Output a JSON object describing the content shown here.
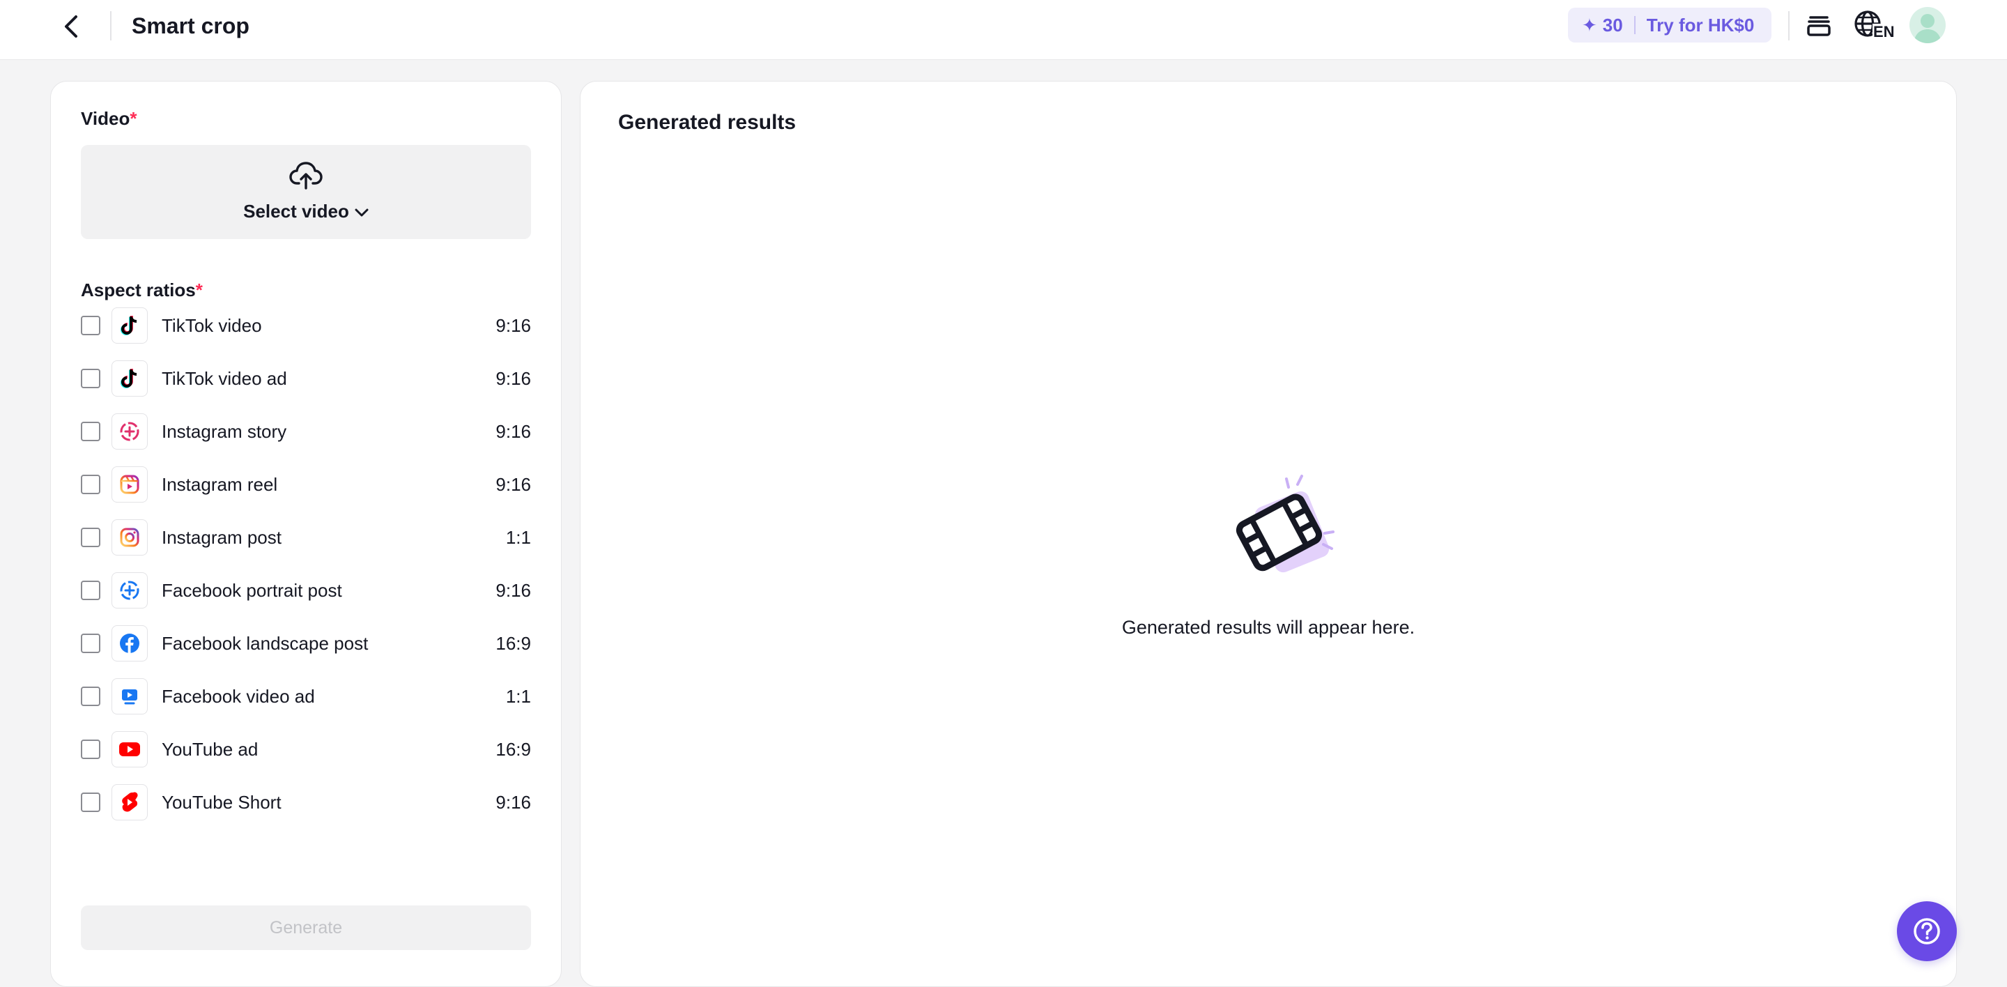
{
  "header": {
    "title": "Smart crop",
    "credits": "30",
    "try_label": "Try for HK$0",
    "language_code": "EN"
  },
  "left_panel": {
    "video_label": "Video",
    "video_required_mark": "*",
    "select_video_label": "Select video",
    "aspect_ratios_label": "Aspect ratios",
    "aspect_required_mark": "*",
    "ratios": [
      {
        "name": "TikTok video",
        "ratio": "9:16",
        "icon": "tiktok-icon",
        "checked": false
      },
      {
        "name": "TikTok video ad",
        "ratio": "9:16",
        "icon": "tiktok-icon",
        "checked": false
      },
      {
        "name": "Instagram story",
        "ratio": "9:16",
        "icon": "instagram-story-icon",
        "checked": false
      },
      {
        "name": "Instagram reel",
        "ratio": "9:16",
        "icon": "instagram-reel-icon",
        "checked": false
      },
      {
        "name": "Instagram post",
        "ratio": "1:1",
        "icon": "instagram-icon",
        "checked": false
      },
      {
        "name": "Facebook portrait post",
        "ratio": "9:16",
        "icon": "facebook-story-icon",
        "checked": false
      },
      {
        "name": "Facebook landscape post",
        "ratio": "16:9",
        "icon": "facebook-icon",
        "checked": false
      },
      {
        "name": "Facebook video ad",
        "ratio": "1:1",
        "icon": "facebook-video-icon",
        "checked": false
      },
      {
        "name": "YouTube ad",
        "ratio": "16:9",
        "icon": "youtube-icon",
        "checked": false
      },
      {
        "name": "YouTube Short",
        "ratio": "9:16",
        "icon": "youtube-shorts-icon",
        "checked": false
      }
    ],
    "generate_label": "Generate"
  },
  "right_panel": {
    "title": "Generated results",
    "empty_message": "Generated results will appear here."
  },
  "colors": {
    "accent": "#6a5ae0",
    "help_button": "#6a4ae6",
    "required": "#fe2c55"
  }
}
